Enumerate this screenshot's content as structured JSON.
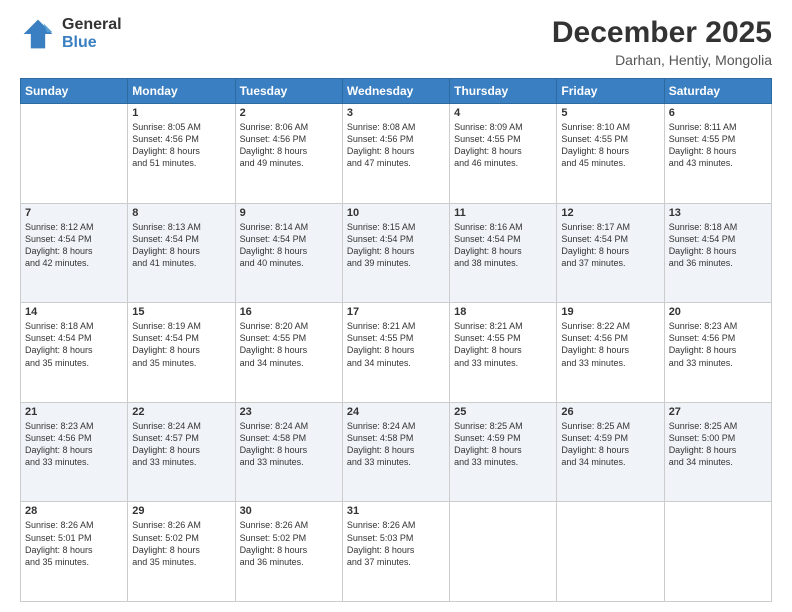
{
  "logo": {
    "general": "General",
    "blue": "Blue"
  },
  "header": {
    "month": "December 2025",
    "location": "Darhan, Hentiy, Mongolia"
  },
  "weekdays": [
    "Sunday",
    "Monday",
    "Tuesday",
    "Wednesday",
    "Thursday",
    "Friday",
    "Saturday"
  ],
  "weeks": [
    [
      {
        "day": "",
        "text": ""
      },
      {
        "day": "1",
        "text": "Sunrise: 8:05 AM\nSunset: 4:56 PM\nDaylight: 8 hours\nand 51 minutes."
      },
      {
        "day": "2",
        "text": "Sunrise: 8:06 AM\nSunset: 4:56 PM\nDaylight: 8 hours\nand 49 minutes."
      },
      {
        "day": "3",
        "text": "Sunrise: 8:08 AM\nSunset: 4:56 PM\nDaylight: 8 hours\nand 47 minutes."
      },
      {
        "day": "4",
        "text": "Sunrise: 8:09 AM\nSunset: 4:55 PM\nDaylight: 8 hours\nand 46 minutes."
      },
      {
        "day": "5",
        "text": "Sunrise: 8:10 AM\nSunset: 4:55 PM\nDaylight: 8 hours\nand 45 minutes."
      },
      {
        "day": "6",
        "text": "Sunrise: 8:11 AM\nSunset: 4:55 PM\nDaylight: 8 hours\nand 43 minutes."
      }
    ],
    [
      {
        "day": "7",
        "text": "Sunrise: 8:12 AM\nSunset: 4:54 PM\nDaylight: 8 hours\nand 42 minutes."
      },
      {
        "day": "8",
        "text": "Sunrise: 8:13 AM\nSunset: 4:54 PM\nDaylight: 8 hours\nand 41 minutes."
      },
      {
        "day": "9",
        "text": "Sunrise: 8:14 AM\nSunset: 4:54 PM\nDaylight: 8 hours\nand 40 minutes."
      },
      {
        "day": "10",
        "text": "Sunrise: 8:15 AM\nSunset: 4:54 PM\nDaylight: 8 hours\nand 39 minutes."
      },
      {
        "day": "11",
        "text": "Sunrise: 8:16 AM\nSunset: 4:54 PM\nDaylight: 8 hours\nand 38 minutes."
      },
      {
        "day": "12",
        "text": "Sunrise: 8:17 AM\nSunset: 4:54 PM\nDaylight: 8 hours\nand 37 minutes."
      },
      {
        "day": "13",
        "text": "Sunrise: 8:18 AM\nSunset: 4:54 PM\nDaylight: 8 hours\nand 36 minutes."
      }
    ],
    [
      {
        "day": "14",
        "text": "Sunrise: 8:18 AM\nSunset: 4:54 PM\nDaylight: 8 hours\nand 35 minutes."
      },
      {
        "day": "15",
        "text": "Sunrise: 8:19 AM\nSunset: 4:54 PM\nDaylight: 8 hours\nand 35 minutes."
      },
      {
        "day": "16",
        "text": "Sunrise: 8:20 AM\nSunset: 4:55 PM\nDaylight: 8 hours\nand 34 minutes."
      },
      {
        "day": "17",
        "text": "Sunrise: 8:21 AM\nSunset: 4:55 PM\nDaylight: 8 hours\nand 34 minutes."
      },
      {
        "day": "18",
        "text": "Sunrise: 8:21 AM\nSunset: 4:55 PM\nDaylight: 8 hours\nand 33 minutes."
      },
      {
        "day": "19",
        "text": "Sunrise: 8:22 AM\nSunset: 4:56 PM\nDaylight: 8 hours\nand 33 minutes."
      },
      {
        "day": "20",
        "text": "Sunrise: 8:23 AM\nSunset: 4:56 PM\nDaylight: 8 hours\nand 33 minutes."
      }
    ],
    [
      {
        "day": "21",
        "text": "Sunrise: 8:23 AM\nSunset: 4:56 PM\nDaylight: 8 hours\nand 33 minutes."
      },
      {
        "day": "22",
        "text": "Sunrise: 8:24 AM\nSunset: 4:57 PM\nDaylight: 8 hours\nand 33 minutes."
      },
      {
        "day": "23",
        "text": "Sunrise: 8:24 AM\nSunset: 4:58 PM\nDaylight: 8 hours\nand 33 minutes."
      },
      {
        "day": "24",
        "text": "Sunrise: 8:24 AM\nSunset: 4:58 PM\nDaylight: 8 hours\nand 33 minutes."
      },
      {
        "day": "25",
        "text": "Sunrise: 8:25 AM\nSunset: 4:59 PM\nDaylight: 8 hours\nand 33 minutes."
      },
      {
        "day": "26",
        "text": "Sunrise: 8:25 AM\nSunset: 4:59 PM\nDaylight: 8 hours\nand 34 minutes."
      },
      {
        "day": "27",
        "text": "Sunrise: 8:25 AM\nSunset: 5:00 PM\nDaylight: 8 hours\nand 34 minutes."
      }
    ],
    [
      {
        "day": "28",
        "text": "Sunrise: 8:26 AM\nSunset: 5:01 PM\nDaylight: 8 hours\nand 35 minutes."
      },
      {
        "day": "29",
        "text": "Sunrise: 8:26 AM\nSunset: 5:02 PM\nDaylight: 8 hours\nand 35 minutes."
      },
      {
        "day": "30",
        "text": "Sunrise: 8:26 AM\nSunset: 5:02 PM\nDaylight: 8 hours\nand 36 minutes."
      },
      {
        "day": "31",
        "text": "Sunrise: 8:26 AM\nSunset: 5:03 PM\nDaylight: 8 hours\nand 37 minutes."
      },
      {
        "day": "",
        "text": ""
      },
      {
        "day": "",
        "text": ""
      },
      {
        "day": "",
        "text": ""
      }
    ]
  ]
}
